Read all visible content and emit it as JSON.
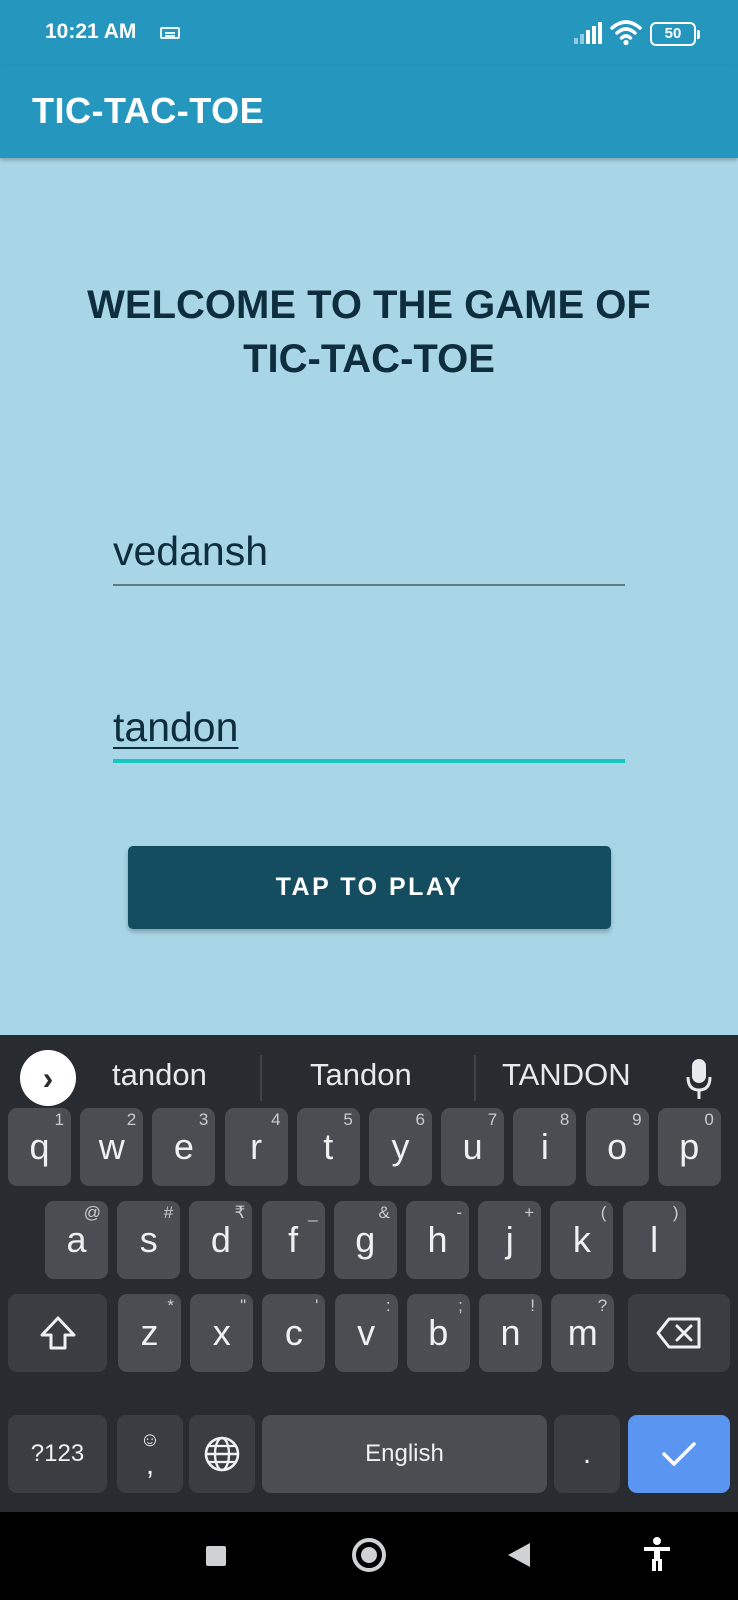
{
  "status_bar": {
    "time": "10:21 AM",
    "battery": "50",
    "icons": [
      "keyboard-indicator-icon",
      "signal-icon",
      "wifi-icon",
      "battery-icon"
    ]
  },
  "app_bar": {
    "title": "TIC-TAC-TOE"
  },
  "main": {
    "welcome_line1": "WELCOME TO THE GAME OF",
    "welcome_line2": "TIC-TAC-TOE",
    "player1_value": "vedansh",
    "player2_value": "tandon",
    "play_button": "TAP TO PLAY"
  },
  "keyboard": {
    "suggestions": [
      "tandon",
      "Tandon",
      "TANDON"
    ],
    "row1": [
      {
        "k": "q",
        "h": "1"
      },
      {
        "k": "w",
        "h": "2"
      },
      {
        "k": "e",
        "h": "3"
      },
      {
        "k": "r",
        "h": "4"
      },
      {
        "k": "t",
        "h": "5"
      },
      {
        "k": "y",
        "h": "6"
      },
      {
        "k": "u",
        "h": "7"
      },
      {
        "k": "i",
        "h": "8"
      },
      {
        "k": "o",
        "h": "9"
      },
      {
        "k": "p",
        "h": "0"
      }
    ],
    "row2": [
      {
        "k": "a",
        "h": "@"
      },
      {
        "k": "s",
        "h": "#"
      },
      {
        "k": "d",
        "h": "₹"
      },
      {
        "k": "f",
        "h": "_"
      },
      {
        "k": "g",
        "h": "&"
      },
      {
        "k": "h",
        "h": "-"
      },
      {
        "k": "j",
        "h": "+"
      },
      {
        "k": "k",
        "h": "("
      },
      {
        "k": "l",
        "h": ")"
      }
    ],
    "row3": [
      {
        "k": "z",
        "h": "*"
      },
      {
        "k": "x",
        "h": "\""
      },
      {
        "k": "c",
        "h": "'"
      },
      {
        "k": "v",
        "h": ":"
      },
      {
        "k": "b",
        "h": ";"
      },
      {
        "k": "n",
        "h": "!"
      },
      {
        "k": "m",
        "h": "?"
      }
    ],
    "symbols_key": "?123",
    "comma_key": ",",
    "space_key": "English",
    "period_key": "."
  },
  "colors": {
    "app_bar": "#2596be",
    "background": "#a9d6e6",
    "button": "#144d60",
    "focus_underline": "#14c7c2",
    "keyboard": "#282c30",
    "enter_key": "#5b95f2"
  }
}
